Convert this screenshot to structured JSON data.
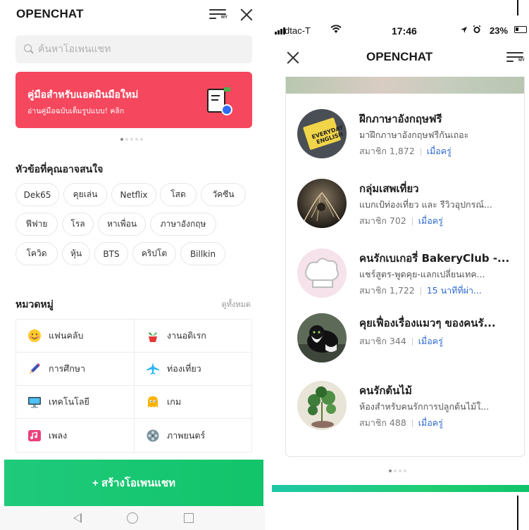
{
  "left": {
    "logo": "OPENCHAT",
    "my_label": "MY",
    "search": {
      "placeholder": "ค้นหาโอเพนแชท"
    },
    "banner": {
      "title": "คู่มือสำหรับแอดมินมือใหม่",
      "subtitle": "อ่านคู่มือฉบับเต็มรูปแบบ! คลิก"
    },
    "topics_title": "หัวข้อที่คุณอาจสนใจ",
    "topics": [
      "Dek65",
      "คุยเล่น",
      "Netflix",
      "โสด",
      "วัคซีน",
      "ฟีฟาย",
      "โรล",
      "หาเพื่อน",
      "ภาษาอังกฤษ",
      "โควิด",
      "หุ้น",
      "BTS",
      "คริปโต",
      "Billkin"
    ],
    "categories_title": "หมวดหมู่",
    "see_all": "ดูทั้งหมด",
    "categories": [
      {
        "label": "แฟนคลับ",
        "icon": "smiley-face-icon"
      },
      {
        "label": "งานอดิเรก",
        "icon": "plant-pot-icon"
      },
      {
        "label": "การศึกษา",
        "icon": "pencil-icon"
      },
      {
        "label": "ท่องเที่ยว",
        "icon": "airplane-icon"
      },
      {
        "label": "เทคโนโลยี",
        "icon": "computer-monitor-icon"
      },
      {
        "label": "เกม",
        "icon": "ghost-icon"
      },
      {
        "label": "เพลง",
        "icon": "music-note-icon"
      },
      {
        "label": "ภาพยนตร์",
        "icon": "film-reel-icon"
      }
    ],
    "create_button": "+ สร้างโอเพนแชท",
    "colors": {
      "banner": "#f5475d",
      "create": "#14c66e",
      "link": "#2f6ad0"
    }
  },
  "right": {
    "status": {
      "carrier": "dtac-T",
      "time": "17:46",
      "battery": "23%"
    },
    "logo": "OPENCHAT",
    "my_label": "MY",
    "rooms": [
      {
        "name": "ฝึกภาษาอังกฤษฟรี",
        "desc": "มาฝึกภาษาอังกฤษฟรีกันเถอะ",
        "members": "สมาชิก 1,872",
        "when": "เมื่อครู่"
      },
      {
        "name": "กลุ่มเสพเที่ยว",
        "desc": "แบกเป้ท่องเที่ยว และ รีวิวอุปกรณ์...",
        "members": "สมาชิก 702",
        "when": "เมื่อครู่"
      },
      {
        "name": "คนรักเบเกอรี่ BakeryClub -...",
        "desc": "แชร์สูตร-พูดคุย-แลกเปลี่ยนเทค...",
        "members": "สมาชิก 1,722",
        "when": "15 นาทีที่ผ่า..."
      },
      {
        "name": "คุยเฟื่องเรื่องแมวๆ ของคนรั...",
        "desc": "",
        "members": "สมาชิก 344",
        "when": "เมื่อครู่"
      },
      {
        "name": "คนรักต้นไม้",
        "desc": "ห้องสำหรับคนรักการปลูกต้นไม้ใ...",
        "members": "สมาชิก 488",
        "when": "เมื่อครู่"
      }
    ]
  }
}
